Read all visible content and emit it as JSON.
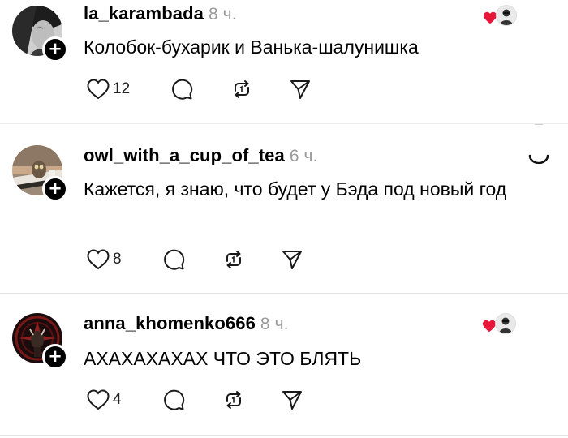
{
  "posts": [
    {
      "username": "la_karambada",
      "time": "8 ч.",
      "text": "Колобок-бухарик и Ванька-шалунишка",
      "likes": "12",
      "liked_by_author": true
    },
    {
      "username": "owl_with_a_cup_of_tea",
      "time": "6 ч.",
      "text": "Кажется, я знаю, что будет у Бэда под новый год",
      "likes": "8",
      "liked_by_author": false
    },
    {
      "username": "anna_khomenko666",
      "time": "8 ч.",
      "text": "АХАХАХАХАХ ЧТО ЭТО БЛЯТЬ",
      "likes": "4",
      "liked_by_author": true
    }
  ],
  "icons": {
    "like": "heart-outline-icon",
    "comment": "comment-bubble-icon",
    "repost": "repost-icon",
    "share": "send-icon",
    "follow": "plus-badge-icon",
    "liked_by": "red-heart-icon"
  },
  "colors": {
    "liked_heart": "#e8173a",
    "time": "#9a9a9a",
    "divider": "#e2e2e2"
  }
}
